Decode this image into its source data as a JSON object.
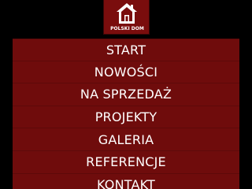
{
  "colors": {
    "background": "#000000",
    "menu_background": "#6f0c0c",
    "menu_divider": "#5e0a0a",
    "logo_background": "#7a0d0d",
    "text": "#ffffff"
  },
  "logo": {
    "icon": "house-icon",
    "text": "POLSKI DOM"
  },
  "menu": {
    "items": [
      {
        "label": "START"
      },
      {
        "label": "NOWOŚCI"
      },
      {
        "label": "NA SPRZEDAŻ"
      },
      {
        "label": "PROJEKTY"
      },
      {
        "label": "GALERIA"
      },
      {
        "label": "REFERENCJE"
      },
      {
        "label": "KONTAKT"
      }
    ]
  }
}
